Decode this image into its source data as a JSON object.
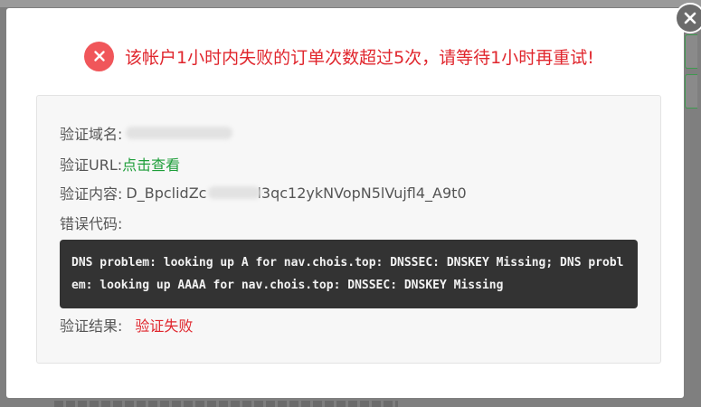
{
  "modal": {
    "header_message": "该帐户1小时内失败的订单次数超过5次，请等待1小时再重试!",
    "close_icon": "close-icon",
    "error_icon": "x-circle-icon"
  },
  "details": {
    "domain_label": "验证域名:",
    "domain_value": "",
    "url_label": "验证URL:",
    "url_link_text": "点击查看",
    "content_label": "验证内容:",
    "content_value_start": "D_BpclidZc",
    "content_value_end": "l3qc12ykNVopN5lVujfl4_A9t0",
    "error_code_label": "错误代码:",
    "error_code_text": "DNS problem: looking up A for nav.chois.top: DNSSEC: DNSKEY Missing; DNS problem: looking up AAAA for nav.chois.top: DNSSEC: DNSKEY Missing",
    "result_label": "验证结果:",
    "result_value": "验证失败"
  },
  "colors": {
    "error_red": "#e0262d",
    "error_icon_bg": "#f0565a",
    "link_green": "#1e9e3a",
    "code_bg": "#333333",
    "panel_bg": "#f7f7f7"
  }
}
